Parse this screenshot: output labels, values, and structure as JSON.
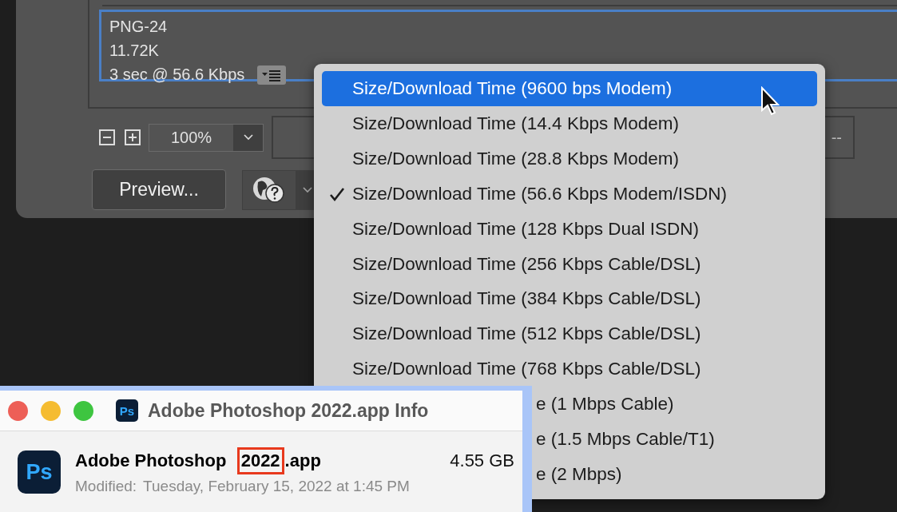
{
  "dialog": {
    "preview": {
      "format": "PNG-24",
      "size": "11.72K",
      "time": "3 sec @ 56.6 Kbps"
    },
    "zoom": {
      "value": "100%"
    },
    "readout": "--",
    "preview_button": "Preview..."
  },
  "menu": {
    "items": [
      {
        "label": "Size/Download Time (9600 bps Modem)",
        "selected": true,
        "checked": false,
        "kind": "full"
      },
      {
        "label": "Size/Download Time (14.4 Kbps Modem)",
        "selected": false,
        "checked": false,
        "kind": "full"
      },
      {
        "label": "Size/Download Time (28.8 Kbps Modem)",
        "selected": false,
        "checked": false,
        "kind": "full"
      },
      {
        "label": "Size/Download Time (56.6 Kbps Modem/ISDN)",
        "selected": false,
        "checked": true,
        "kind": "full"
      },
      {
        "label": "Size/Download Time (128 Kbps Dual ISDN)",
        "selected": false,
        "checked": false,
        "kind": "full"
      },
      {
        "label": "Size/Download Time (256 Kbps Cable/DSL)",
        "selected": false,
        "checked": false,
        "kind": "full"
      },
      {
        "label": "Size/Download Time (384 Kbps Cable/DSL)",
        "selected": false,
        "checked": false,
        "kind": "full"
      },
      {
        "label": "Size/Download Time (512 Kbps Cable/DSL)",
        "selected": false,
        "checked": false,
        "kind": "full"
      },
      {
        "label": "Size/Download Time (768 Kbps Cable/DSL)",
        "selected": false,
        "checked": false,
        "kind": "full"
      },
      {
        "label": "e (1 Mbps Cable)",
        "selected": false,
        "checked": false,
        "kind": "clipped"
      },
      {
        "label": "e (1.5 Mbps Cable/T1)",
        "selected": false,
        "checked": false,
        "kind": "clipped"
      },
      {
        "label": "e (2 Mbps)",
        "selected": false,
        "checked": false,
        "kind": "clipped"
      }
    ]
  },
  "info_window": {
    "title": "Adobe Photoshop 2022.app Info",
    "app_icon_label": "Ps",
    "title_icon_label": "Ps",
    "name": {
      "before": "Adobe Photoshop ",
      "marked": "2022",
      "after": ".app"
    },
    "size": "4.55 GB",
    "modified_label": "Modified:",
    "modified": "Tuesday, February 15, 2022 at 1:45 PM"
  }
}
